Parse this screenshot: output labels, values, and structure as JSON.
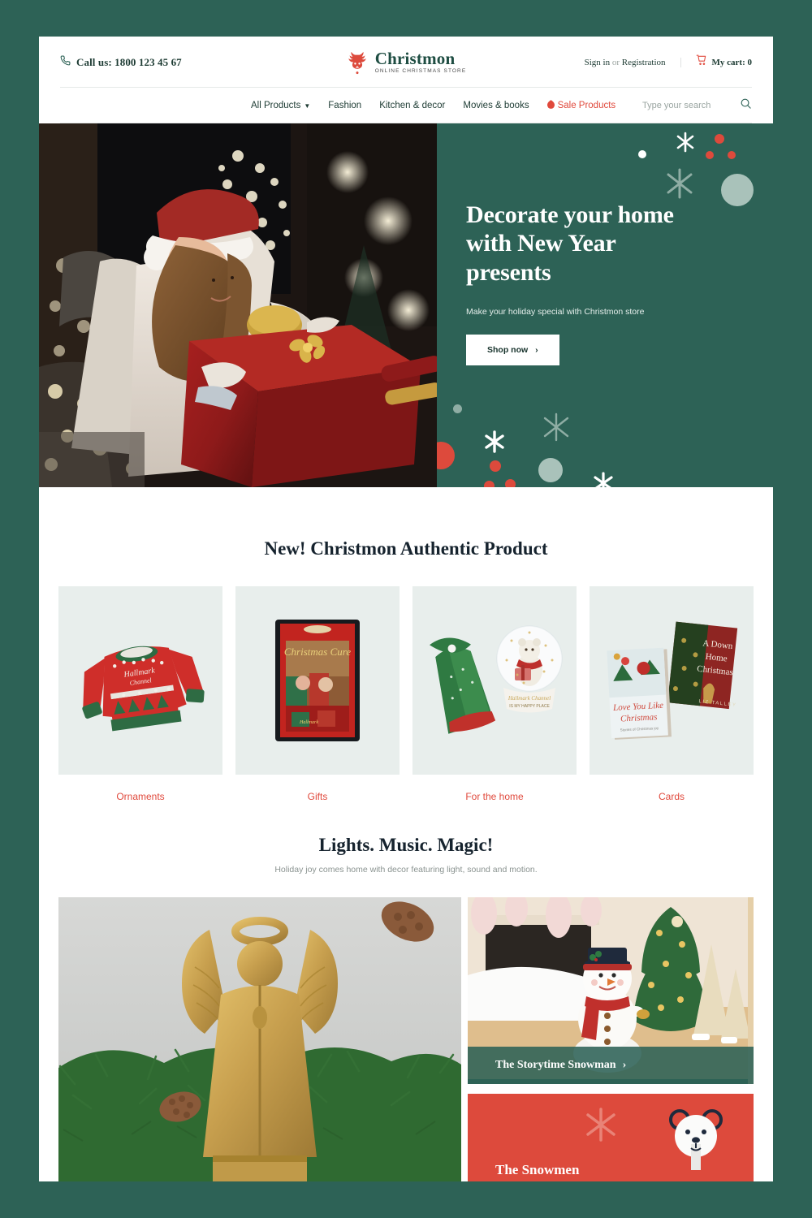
{
  "header": {
    "phone_icon": "phone-icon",
    "phone_label": "Call us: 1800 123 45 67",
    "logo_icon": "reindeer-icon",
    "logo_name": "Christmon",
    "logo_tagline": "ONLINE CHRISTMAS STORE",
    "sign_in": "Sign in",
    "or": " or ",
    "registration": "Registration",
    "cart_icon": "cart-icon",
    "cart_label": "My cart: 0"
  },
  "nav": {
    "items": [
      {
        "label": "All Products",
        "has_caret": true
      },
      {
        "label": "Fashion",
        "has_caret": false
      },
      {
        "label": "Kitchen & decor",
        "has_caret": false
      },
      {
        "label": "Movies & books",
        "has_caret": false
      },
      {
        "label": "Sale Products",
        "has_caret": false,
        "sale": true
      }
    ],
    "search_placeholder": "Type your search",
    "search_value": "",
    "search_icon": "search-icon"
  },
  "hero": {
    "image_alt": "woman-in-santa-hat-wrapping-red-gift-box",
    "title": "Decorate your home with New Year presents",
    "subtitle": "Make your holiday special with Christmon store",
    "button_label": "Shop now",
    "button_arrow": "›"
  },
  "products_section": {
    "title": "New! Christmon Authentic Product",
    "categories": [
      {
        "label": "Ornaments",
        "image_alt": "red-christmas-sweater"
      },
      {
        "label": "Gifts",
        "image_alt": "the-christmas-cure-dvd"
      },
      {
        "label": "For the home",
        "image_alt": "polar-bear-snow-globe-and-green-gift-bag"
      },
      {
        "label": "Cards",
        "image_alt": "christmas-books-pair"
      }
    ]
  },
  "lights_section": {
    "title": "Lights. Music. Magic!",
    "subtitle": "Holiday joy comes home with decor featuring light, sound and motion.",
    "angel_alt": "gold-angel-figurine-with-pine-garland",
    "snowman": {
      "image_alt": "plush-snowman-with-top-hat-and-red-scarf",
      "label": "The Storytime Snowman",
      "arrow": "›"
    },
    "snowmen": {
      "label": "The Snowmen",
      "bear_icon": "polar-bear-icon"
    }
  },
  "colors": {
    "brand_green": "#2d6256",
    "brand_red": "#e0493c",
    "dark_text": "#16232e",
    "page_bg": "#ffffff",
    "tile_bg": "#e8eeec",
    "snowmen_red": "#dd4a3c"
  }
}
